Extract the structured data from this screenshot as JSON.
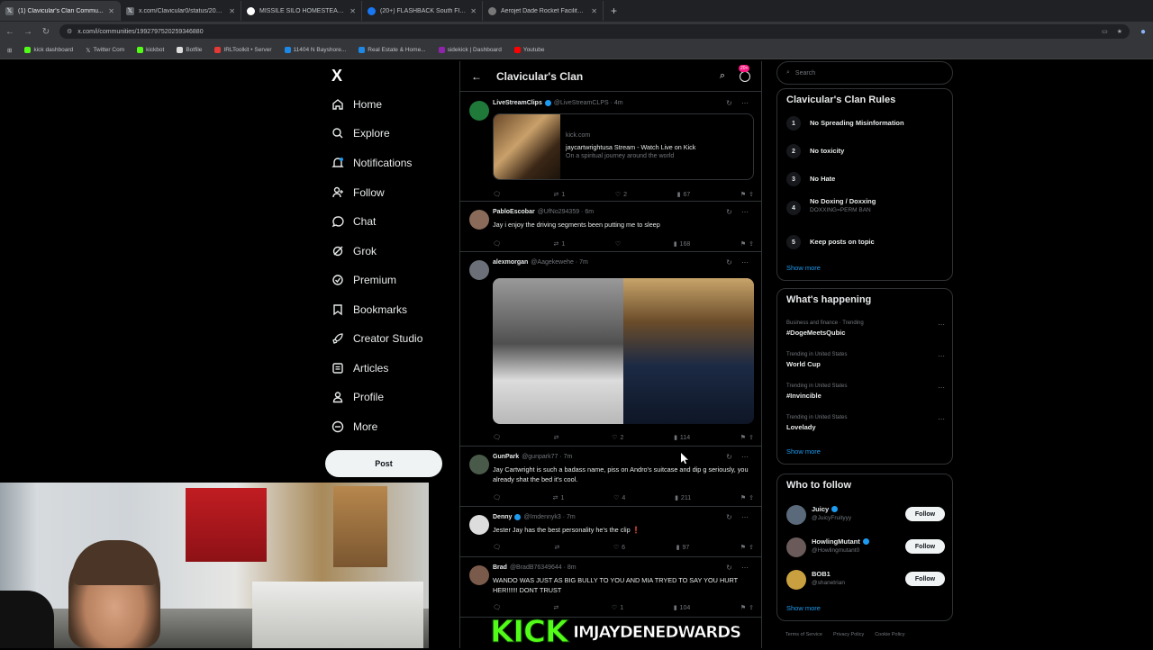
{
  "browser": {
    "tabs": [
      {
        "title": "(1) Clavicular's Clan Commu...",
        "icon": "x-icon",
        "active": true
      },
      {
        "title": "x.com/Clavicular0/status/2039...",
        "icon": "x-icon",
        "active": false
      },
      {
        "title": "MISSILE SILO HOMESTEAD - G...",
        "icon": "google-icon",
        "active": false
      },
      {
        "title": "(20+) FLASHBACK South Florid...",
        "icon": "facebook-icon",
        "active": false
      },
      {
        "title": "Aerojet Dade Rocket Facility | ...",
        "icon": "globe-icon",
        "active": false
      }
    ],
    "new_tab": "+",
    "url": "x.com/i/communities/1992797520259346880",
    "bookmarks": [
      {
        "label": "kick dashboard",
        "color": "#53fc18"
      },
      {
        "label": "Twitter Com",
        "color": "#ffffff"
      },
      {
        "label": "kickbot",
        "color": "#53fc18"
      },
      {
        "label": "Botfile",
        "color": "#dddddd"
      },
      {
        "label": "IRLToolkit • Server",
        "color": "#e53935"
      },
      {
        "label": "11404 N Bayshore...",
        "color": "#1e88e5"
      },
      {
        "label": "Real Estate & Home...",
        "color": "#1e88e5"
      },
      {
        "label": "sidekick | Dashboard",
        "color": "#8e24aa"
      },
      {
        "label": "Youtube",
        "color": "#ff0000"
      }
    ]
  },
  "nav": {
    "logo": "X",
    "items": [
      {
        "label": "Home",
        "icon": "home-icon"
      },
      {
        "label": "Explore",
        "icon": "search-icon"
      },
      {
        "label": "Notifications",
        "icon": "bell-icon"
      },
      {
        "label": "Follow",
        "icon": "follow-icon"
      },
      {
        "label": "Chat",
        "icon": "chat-icon"
      },
      {
        "label": "Grok",
        "icon": "grok-icon"
      },
      {
        "label": "Premium",
        "icon": "premium-icon"
      },
      {
        "label": "Bookmarks",
        "icon": "bookmark-icon"
      },
      {
        "label": "Creator Studio",
        "icon": "rocket-icon"
      },
      {
        "label": "Articles",
        "icon": "articles-icon"
      },
      {
        "label": "Profile",
        "icon": "profile-icon"
      },
      {
        "label": "More",
        "icon": "more-icon"
      }
    ],
    "post_button": "Post"
  },
  "feed": {
    "title": "Clavicular's Clan",
    "badge": "20+",
    "posts": [
      {
        "name": "LiveStreamClips",
        "verified": true,
        "handle": "@LiveStreamCLPS · 4m",
        "text": "",
        "card": {
          "domain": "kick.com",
          "title": "jaycartwrightusa Stream - Watch Live on Kick",
          "desc": "On a spiritual journey around the world"
        },
        "stats": {
          "reply": "",
          "repost": "1",
          "like": "2",
          "views": "67"
        },
        "avatar_color": "#1f7a3a"
      },
      {
        "name": "PabloEscobar",
        "verified": false,
        "handle": "@UfNo294359 · 6m",
        "text": "Jay i enjoy the driving segments been putting me to sleep",
        "stats": {
          "reply": "",
          "repost": "1",
          "like": "",
          "views": "168"
        },
        "avatar_color": "#8a6b5a"
      },
      {
        "name": "alexmorgan",
        "verified": false,
        "handle": "@Aagekewehe · 7m",
        "text": "",
        "stats": {
          "reply": "",
          "repost": "",
          "like": "2",
          "views": "114"
        },
        "avatar_color": "#6b7078"
      },
      {
        "name": "GunPark",
        "verified": false,
        "handle": "@gunpark77 · 7m",
        "text": "Jay Cartwright is such a badass name, piss on Andro's suitcase and dip g seriously, you already shat the bed it's cool.",
        "stats": {
          "reply": "",
          "repost": "1",
          "like": "4",
          "views": "211"
        },
        "avatar_color": "#4a5a4a"
      },
      {
        "name": "Denny",
        "verified": true,
        "handle": "@Imdennyk3 · 7m",
        "text": "Jester Jay has the best personality he's the clip ❗",
        "stats": {
          "reply": "",
          "repost": "",
          "like": "6",
          "views": "97"
        },
        "avatar_color": "#dddddd"
      },
      {
        "name": "Brad",
        "verified": false,
        "handle": "@BradB76349644 · 8m",
        "text": "WANDO WAS JUST AS BIG BULLY TO YOU AND MIA TRYED TO SAY YOU HURT HER!!!!!! DONT TRUST",
        "stats": {
          "reply": "",
          "repost": "",
          "like": "1",
          "views": "104"
        },
        "avatar_color": "#7a5a4a"
      }
    ]
  },
  "right": {
    "search_placeholder": "Search",
    "rules_title": "Clavicular's Clan Rules",
    "rules": [
      {
        "n": "1",
        "text": "No Spreading Misinformation",
        "sub": ""
      },
      {
        "n": "2",
        "text": "No toxicity",
        "sub": ""
      },
      {
        "n": "3",
        "text": "No Hate",
        "sub": ""
      },
      {
        "n": "4",
        "text": "No Doxing / Doxxing",
        "sub": "DOXXING=PERM BAN"
      },
      {
        "n": "5",
        "text": "Keep posts on topic",
        "sub": ""
      }
    ],
    "show_more": "Show more",
    "happening_title": "What's happening",
    "trends": [
      {
        "context": "Business and finance · Trending",
        "name": "#DogeMeetsQubic"
      },
      {
        "context": "Trending in United States",
        "name": "World Cup"
      },
      {
        "context": "Trending in United States",
        "name": "#Invincible"
      },
      {
        "context": "Trending in United States",
        "name": "Lovelady"
      }
    ],
    "who_title": "Who to follow",
    "who": [
      {
        "name": "Juicy",
        "verified": true,
        "handle": "@JuicyFruityyy",
        "button": "Follow",
        "avatar_color": "#5a6a7a"
      },
      {
        "name": "HowlingMutant",
        "verified": true,
        "handle": "@Howlingmutant0",
        "button": "Follow",
        "avatar_color": "#6a5a5a"
      },
      {
        "name": "BOB1",
        "verified": false,
        "handle": "@shanetrian",
        "button": "Follow",
        "avatar_color": "#c9a040"
      }
    ],
    "footer": [
      "Terms of Service",
      "Privacy Policy",
      "Cookie Policy"
    ]
  },
  "overlay": {
    "kick_logo": "KICK",
    "username": "IMJAYDENEDWARDS",
    "kick_color": "#53fc18"
  }
}
